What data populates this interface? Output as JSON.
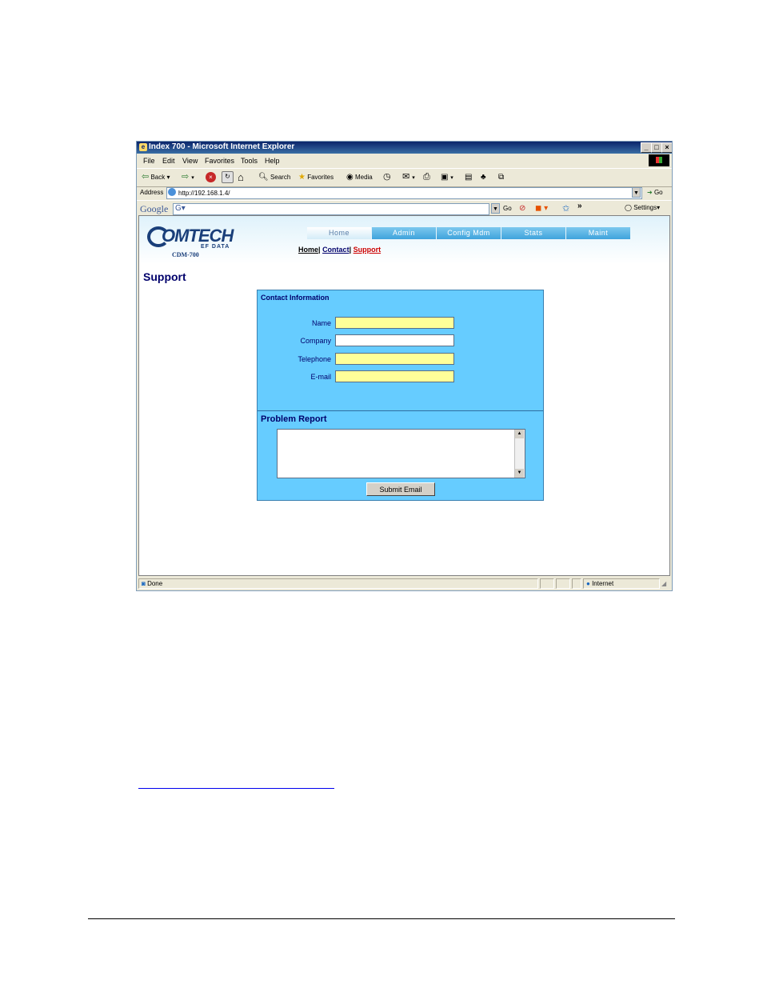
{
  "window": {
    "title": "Index 700 - Microsoft Internet Explorer",
    "minimize": "_",
    "maximize": "□",
    "close": "×"
  },
  "menu": [
    "File",
    "Edit",
    "View",
    "Favorites",
    "Tools",
    "Help"
  ],
  "toolbar": {
    "back": "Back",
    "search": "Search",
    "favorites": "Favorites",
    "media": "Media"
  },
  "address": {
    "label": "Address",
    "url": "http://192.168.1.4/",
    "go": "Go"
  },
  "google": {
    "logo": "Google",
    "go": "Go",
    "settings": "Settings"
  },
  "brand": {
    "name": "OMTECH",
    "sub": "EF DATA",
    "model": "CDM-700"
  },
  "nav": {
    "tabs": [
      {
        "label": "Home",
        "active": true
      },
      {
        "label": "Admin",
        "active": false
      },
      {
        "label": "Config Mdm",
        "active": false
      },
      {
        "label": "Stats",
        "active": false
      },
      {
        "label": "Maint",
        "active": false
      }
    ],
    "sub": {
      "home": "Home",
      "contact": "Contact",
      "support": "Support"
    }
  },
  "page": {
    "title": "Support"
  },
  "contact": {
    "heading": "Contact Information",
    "fields": [
      {
        "label": "Name",
        "value": "",
        "required": true
      },
      {
        "label": "Company",
        "value": "",
        "required": false
      },
      {
        "label": "Telephone",
        "value": "",
        "required": true
      },
      {
        "label": "E-mail",
        "value": "",
        "required": true
      }
    ]
  },
  "problem": {
    "heading": "Problem Report",
    "value": "",
    "submit": "Submit Email"
  },
  "status": {
    "text": "Done",
    "zone": "Internet"
  },
  "colors": {
    "panel": "#66ccff",
    "required_field": "#ffff99",
    "heading": "#00006b",
    "support_link": "#cc0000"
  }
}
